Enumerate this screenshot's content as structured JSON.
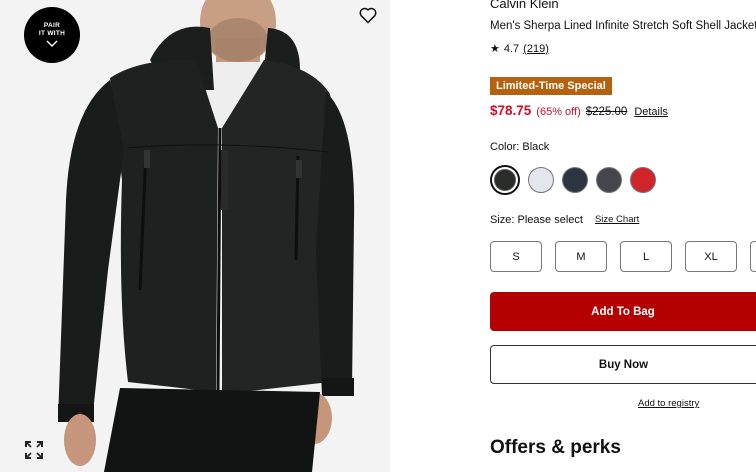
{
  "image_panel": {
    "pair_badge": {
      "line1": "PAIR",
      "line2": "IT WITH"
    },
    "icons": {
      "wishlist": "heart-icon",
      "expand": "expand-icon",
      "pair_chevron": "chevron-down-icon"
    }
  },
  "product": {
    "brand": "Calvin Klein",
    "title": "Men's Sherpa Lined Infinite Stretch Soft Shell Jacket",
    "rating": {
      "star": "★",
      "value": "4.7",
      "count": "(219)"
    },
    "promo_badge": "Limited-Time Special",
    "price": {
      "sale": "$78.75",
      "discount": "(65% off)",
      "original": "$225.00",
      "details_link": "Details"
    },
    "color": {
      "label": "Color: Black",
      "swatches": [
        {
          "name": "Black",
          "hex": "#2b2d2a",
          "selected": true
        },
        {
          "name": "White",
          "hex": "#e4e6ef",
          "selected": false
        },
        {
          "name": "Navy",
          "hex": "#2e3440",
          "selected": false
        },
        {
          "name": "Charcoal",
          "hex": "#45464b",
          "selected": false
        },
        {
          "name": "Red",
          "hex": "#d0252b",
          "selected": false
        }
      ]
    },
    "size": {
      "label": "Size: Please select",
      "chart_link": "Size Chart",
      "options": [
        "S",
        "M",
        "L",
        "XL"
      ]
    },
    "actions": {
      "add_to_bag": "Add To Bag",
      "buy_now": "Buy Now",
      "registry": "Add to registry"
    },
    "offers_heading": "Offers & perks"
  },
  "colors": {
    "accent_red": "#b40000",
    "price_red": "#c8102e",
    "promo_orange": "#b5620e"
  }
}
